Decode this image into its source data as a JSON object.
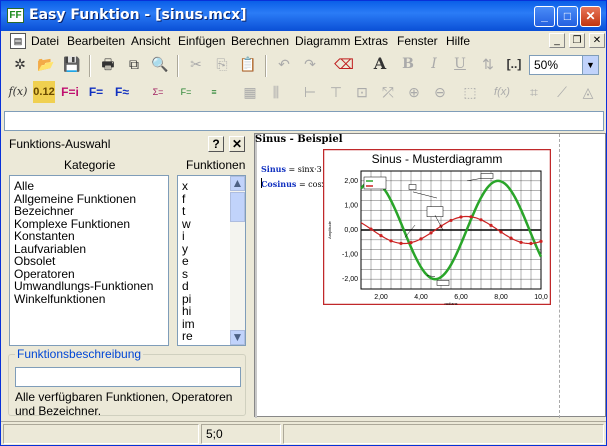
{
  "window": {
    "title": "Easy Funktion - [sinus.mcx]",
    "icon_text": "FF"
  },
  "menu": [
    "Datei",
    "Bearbeiten",
    "Ansicht",
    "Einfügen",
    "Berechnen",
    "Diagramm",
    "Extras",
    "Fenster",
    "Hilfe"
  ],
  "toolbar": {
    "zoom": "50%",
    "fx_label": "f(x)",
    "num_label": "0.12",
    "fi_label": "F=i",
    "f_eq_label": "F=",
    "f_approx_label": "F≈",
    "text_A": "A",
    "bold": "B",
    "italic": "I",
    "underline": "U",
    "brackets": "[..]"
  },
  "panel": {
    "title": "Funktions-Auswahl",
    "help_btn": "?",
    "close_btn": "✕",
    "col_category": "Kategorie",
    "col_functions": "Funktionen",
    "categories": [
      "Alle",
      "Allgemeine Funktionen",
      "Bezeichner",
      "Komplexe Funktionen",
      "Konstanten",
      "Laufvariablen",
      "Obsolet",
      "Operatoren",
      "Umwandlungs-Funktionen",
      "Winkelfunktionen"
    ],
    "functions": [
      "x",
      "f",
      "t",
      "w",
      "i",
      "y",
      "e",
      "s",
      "d",
      "pi",
      "hi",
      "im",
      "re"
    ],
    "desc_title": "Funktionsbeschreibung",
    "desc_input": "",
    "desc_text": "Alle verfügbaren Funktionen, Operatoren und Bezeichner."
  },
  "document": {
    "heading": "Sinus - Beispiel",
    "eq1_label": "Sinus",
    "eq1_expr": "= sinx·3",
    "eq2_label": "Cosinus",
    "eq2_expr": "= cosx·2"
  },
  "status": {
    "position": "5;0"
  },
  "colors": {
    "sin": "#2aa52a",
    "cos": "#cc2222",
    "frame": "#c0282a"
  },
  "chart_data": {
    "type": "line",
    "title": "Sinus - Musterdiagramm",
    "xlabel": "radians",
    "ylabel": "Amplitude",
    "xlim": [
      1.0,
      10.0
    ],
    "ylim": [
      -2.4,
      2.4
    ],
    "xticks": [
      "2,00",
      "4,00",
      "6,00",
      "8,00",
      "10,0"
    ],
    "yticks": [
      "2,00",
      "1,00",
      "0,00",
      "-1,00",
      "-2,00"
    ],
    "series": [
      {
        "name": "Sinus",
        "amplitude": 2,
        "freq": 1
      },
      {
        "name": "Cosinus",
        "amplitude": 0.55,
        "freq": 1
      }
    ]
  }
}
